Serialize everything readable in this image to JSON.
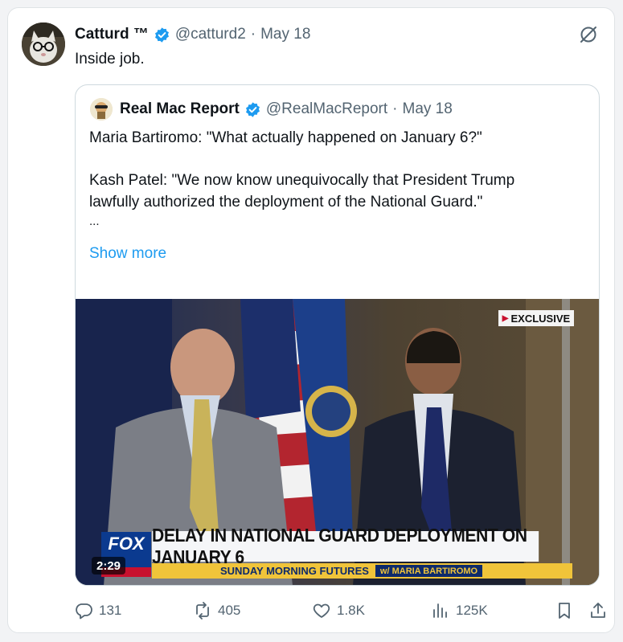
{
  "tweet": {
    "display_name": "Catturd ™",
    "handle": "@catturd2",
    "separator": "·",
    "date": "May 18",
    "text": "Inside job."
  },
  "quote": {
    "display_name": "Real Mac Report",
    "handle": "@RealMacReport",
    "separator": "·",
    "date": "May 18",
    "line1": "Maria Bartiromo: \"What actually happened on January 6?\"",
    "line2": "Kash Patel: \"We now know unequivocally that President Trump",
    "line3": "lawfully authorized the deployment of the National Guard.\"",
    "ellipsis": "...",
    "show_more": "Show more",
    "video": {
      "exclusive_badge": "EXCLUSIVE",
      "chyron": "DELAY IN NATIONAL GUARD DEPLOYMENT ON JANUARY 6",
      "program": "SUNDAY MORNING FUTURES",
      "host": "w/ MARIA BARTIROMO",
      "duration": "2:29"
    }
  },
  "actions": {
    "replies": "131",
    "reposts": "405",
    "likes": "1.8K",
    "views": "125K"
  },
  "colors": {
    "accent": "#1d9bf0",
    "muted": "#536471",
    "text": "#0f1419"
  }
}
